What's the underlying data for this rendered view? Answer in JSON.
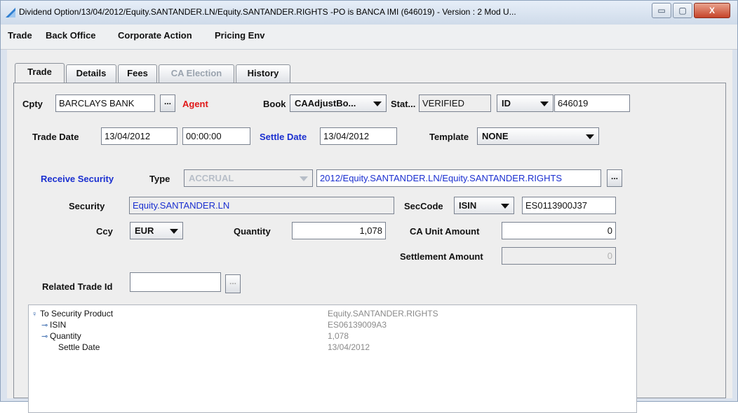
{
  "window": {
    "title": "Dividend Option/13/04/2012/Equity.SANTANDER.LN/Equity.SANTANDER.RIGHTS  -PO is BANCA IMI  (646019) - Version : 2 Mod U...",
    "min_label": "▭",
    "max_label": "▢",
    "close_label": "X"
  },
  "menu": [
    "Trade",
    "Back Office",
    "Corporate Action",
    "Pricing Env"
  ],
  "tabs": [
    {
      "label": "Trade",
      "state": "active"
    },
    {
      "label": "Details",
      "state": "normal"
    },
    {
      "label": "Fees",
      "state": "normal"
    },
    {
      "label": "CA Election",
      "state": "disabled"
    },
    {
      "label": "History",
      "state": "normal"
    }
  ],
  "form": {
    "cpty_label": "Cpty",
    "cpty_value": "BARCLAYS BANK",
    "dots": "...",
    "agent_label": "Agent",
    "book_label": "Book",
    "book_value": "CAAdjustBo...",
    "status_label": "Stat...",
    "status_value": "VERIFIED",
    "id_type": "ID",
    "id_value": "646019",
    "trade_date_label": "Trade Date",
    "trade_date": "13/04/2012",
    "trade_time": "00:00:00",
    "settle_date_label": "Settle Date",
    "settle_date": "13/04/2012",
    "template_label": "Template",
    "template_value": "NONE",
    "receive_security_label": "Receive  Security",
    "type_label": "Type",
    "type_value": "ACCRUAL",
    "security_path": "2012/Equity.SANTANDER.LN/Equity.SANTANDER.RIGHTS",
    "security_label": "Security",
    "security_value": "Equity.SANTANDER.LN",
    "seccode_label": "SecCode",
    "seccode_type": "ISIN",
    "seccode_value": "ES0113900J37",
    "ccy_label": "Ccy",
    "ccy_value": "EUR",
    "quantity_label": "Quantity",
    "quantity_value": "1,078",
    "ca_unit_amount_label": "CA Unit Amount",
    "ca_unit_amount_value": "0",
    "settlement_amount_label": "Settlement Amount",
    "settlement_amount_value": "0",
    "related_trade_label": "Related Trade Id",
    "related_trade_value": ""
  },
  "tree": [
    {
      "key": "To Security Product",
      "value": "Equity.SANTANDER.RIGHTS",
      "icon": "pin-icon",
      "glyph": "♀"
    },
    {
      "key": "ISIN",
      "value": "ES06139009A3",
      "icon": "key-icon",
      "glyph": "⊸"
    },
    {
      "key": "Quantity",
      "value": "1,078",
      "icon": "key-icon",
      "glyph": "⊸"
    },
    {
      "key": "Settle Date",
      "value": "13/04/2012",
      "icon": "",
      "glyph": ""
    }
  ]
}
